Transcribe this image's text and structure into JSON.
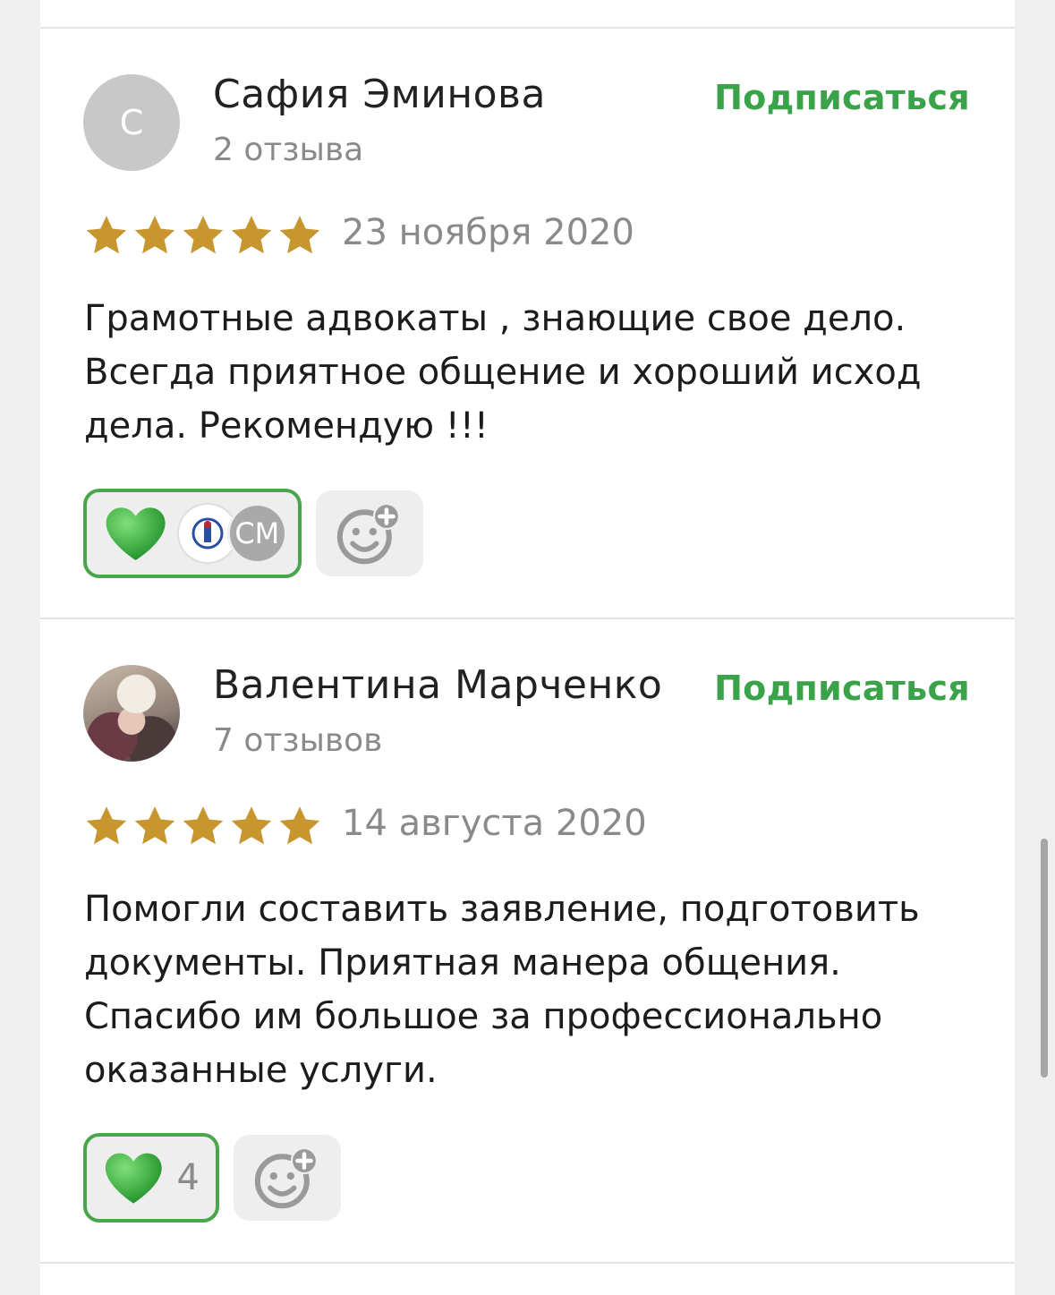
{
  "reviews": [
    {
      "author": "Сафия Эминова",
      "avatar_initial": "С",
      "review_count": "2 отзыва",
      "subscribe_label": "Подписаться",
      "rating": 5,
      "date": "23 ноября 2020",
      "text": "Грамотные адвокаты , знающие свое дело. Всегда приятное общение и хороший исход дела. Рекомендую !!!",
      "reactions": {
        "icon": "green-heart-icon",
        "reactor_avatars": [
          "emblem",
          "СМ"
        ]
      }
    },
    {
      "author": "Валентина Марченко",
      "avatar_initial": "",
      "review_count": "7 отзывов",
      "subscribe_label": "Подписаться",
      "rating": 5,
      "date": "14 августа 2020",
      "text": "Помогли составить заявление, подготовить документы. Приятная манера общения. Спасибо им большое за профессионально оказанные услуги.",
      "reactions": {
        "icon": "green-heart-icon",
        "count": "4"
      }
    }
  ],
  "colors": {
    "accent_green": "#3aa34a",
    "star_gold": "#c8962f",
    "heart_green": "#3cb043",
    "muted_text": "#8a8a8a"
  }
}
